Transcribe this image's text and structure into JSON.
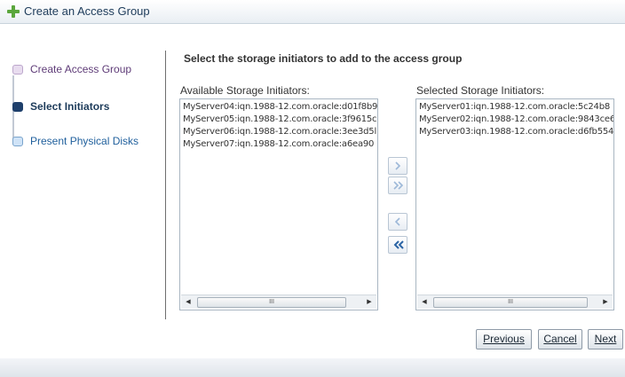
{
  "header": {
    "title": "Create an Access Group",
    "icon": "plus-icon"
  },
  "train": {
    "steps": [
      {
        "label": "Create Access Group",
        "state": "visited"
      },
      {
        "label": "Select Initiators",
        "state": "current"
      },
      {
        "label": "Present Physical Disks",
        "state": "unvisited"
      }
    ]
  },
  "main": {
    "instruction": "Select the storage initiators to add to the access group",
    "available_label": "Available Storage Initiators:",
    "selected_label": "Selected Storage Initiators:",
    "available_items": [
      "MyServer04:iqn.1988-12.com.oracle:d01f8b9",
      "MyServer05:iqn.1988-12.com.oracle:3f9615c",
      "MyServer06:iqn.1988-12.com.oracle:3ee3d5l",
      "MyServer07:iqn.1988-12.com.oracle:a6ea90"
    ],
    "selected_items": [
      "MyServer01:iqn.1988-12.com.oracle:5c24b8",
      "MyServer02:iqn.1988-12.com.oracle:9843ce6",
      "MyServer03:iqn.1988-12.com.oracle:d6fb554"
    ],
    "scroll_thumb_glyph": "III"
  },
  "buttons": {
    "previous": "Previous",
    "cancel": "Cancel",
    "next": "Next"
  },
  "colors": {
    "accent": "#1e3f6b",
    "shuttle_active": "#2b64a5",
    "shuttle_disabled": "#9db8d8"
  }
}
